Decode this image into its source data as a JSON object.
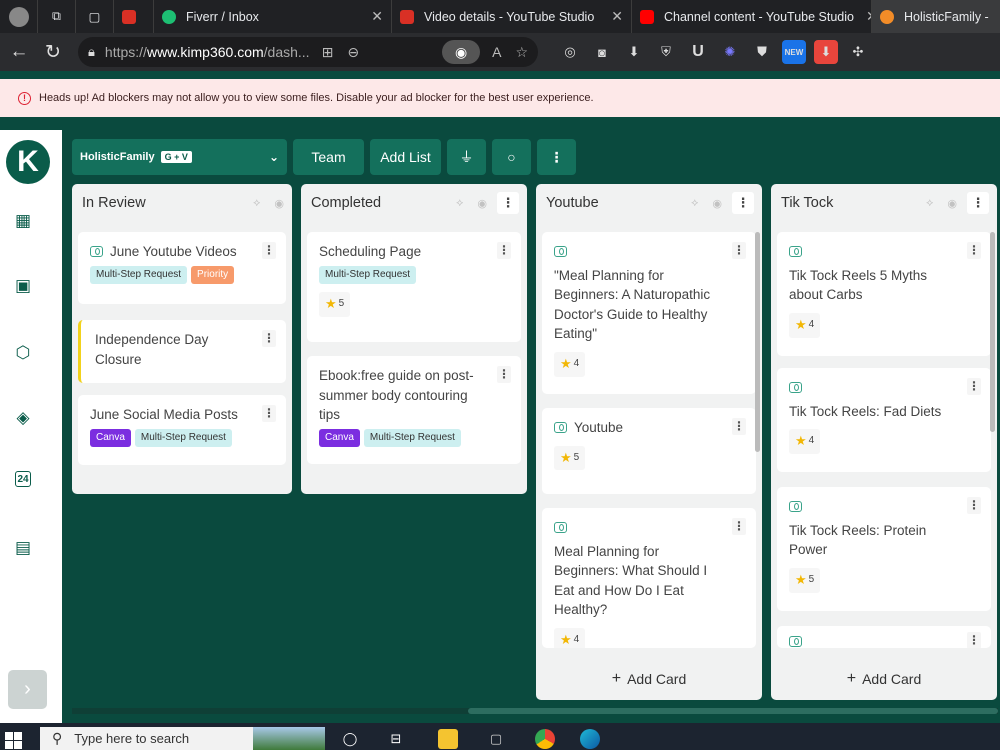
{
  "browser": {
    "tabs": [
      {
        "label": "",
        "favicon_color": "#5f6368"
      },
      {
        "label": "",
        "favicon_color": "#d93025"
      },
      {
        "label": "Fiverr / Inbox",
        "favicon_color": "#1dbf73"
      },
      {
        "label": "Video details - YouTube Studio",
        "favicon_color": "#d93025"
      },
      {
        "label": "Channel content - YouTube Studio",
        "favicon_color": "#ff0000"
      },
      {
        "label": "HolisticFamily -",
        "favicon_color": "#f28c28"
      }
    ],
    "url_prefix": "https://",
    "url_host": "www.kimp360.com",
    "url_path": "/dash..."
  },
  "alert": {
    "text": "Heads up! Ad blockers may not allow you to view some files. Disable your ad blocker for the best user experience."
  },
  "sidebar": {
    "logo_letter": "K",
    "icons": [
      "grid-icon",
      "clipboard-icon",
      "box-icon",
      "diamond-icon",
      "calendar-24-icon",
      "user-card-icon"
    ]
  },
  "toolbar": {
    "project_name": "HolisticFamily",
    "project_tag": "G + V",
    "team_label": "Team",
    "add_list_label": "Add List"
  },
  "columns": [
    {
      "title": "In Review",
      "cards": [
        {
          "title": "June Youtube Videos",
          "video": true,
          "tags": [
            [
              "Multi-Step Request",
              "ms"
            ],
            [
              "Priority",
              "pr"
            ]
          ]
        },
        {
          "title": "Independence Day Closure",
          "video": false,
          "tags": []
        },
        {
          "title": "June Social Media Posts",
          "video": false,
          "tags": [
            [
              "Canva",
              "cv"
            ],
            [
              "Multi-Step Request",
              "ms"
            ]
          ]
        }
      ]
    },
    {
      "title": "Completed",
      "cards": [
        {
          "title": "Scheduling Page",
          "video": false,
          "tags": [
            [
              "Multi-Step Request",
              "ms"
            ]
          ],
          "rating": "5"
        },
        {
          "title": "Ebook:free guide on post-summer body contouring tips",
          "video": false,
          "tags": [
            [
              "Canva",
              "cv"
            ],
            [
              "Multi-Step Request",
              "ms"
            ]
          ]
        }
      ]
    },
    {
      "title": "Youtube",
      "cards": [
        {
          "title": "\"Meal Planning for Beginners: A Naturopathic Doctor's Guide to Healthy Eating\"",
          "video": true,
          "video_block": true,
          "rating": "4"
        },
        {
          "title": "Youtube",
          "video": true,
          "rating": "5"
        },
        {
          "title": "Meal Planning for Beginners: What Should I Eat and How Do I Eat Healthy?",
          "video": true,
          "video_block": true,
          "rating": "4"
        }
      ],
      "add_card": "Add Card"
    },
    {
      "title": "Tik Tock",
      "cards": [
        {
          "title": "Tik Tock Reels 5 Myths about Carbs",
          "video": true,
          "video_block": true,
          "rating": "4"
        },
        {
          "title": "Tik Tock Reels: Fad Diets",
          "video": true,
          "video_block": true,
          "rating": "4"
        },
        {
          "title": "Tik Tock Reels: Protein Power",
          "video": true,
          "video_block": true,
          "rating": "5"
        },
        {
          "title": "",
          "video": true,
          "video_block": true
        }
      ],
      "add_card": "Add Card"
    }
  ],
  "taskbar": {
    "search_placeholder": "Type here to search"
  }
}
